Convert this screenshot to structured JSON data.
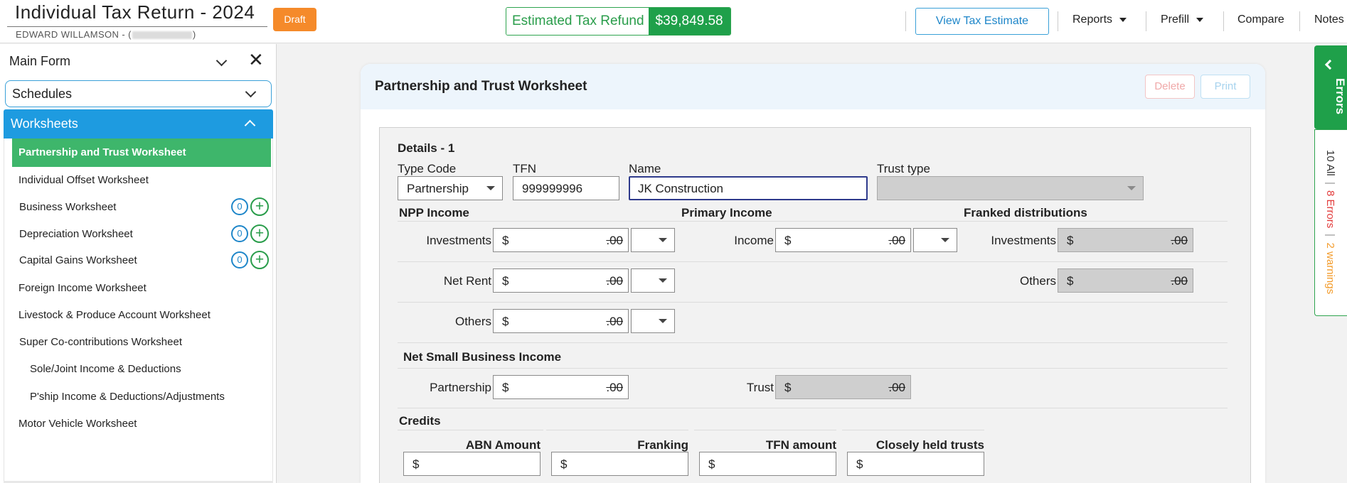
{
  "header": {
    "title": "Individual Tax Return - 2024",
    "client_name": "EDWARD WILLAMSON - (",
    "client_close": ")",
    "status_badge": "Draft",
    "refund_label": "Estimated Tax Refund",
    "refund_amount": "$39,849.58",
    "view_estimate": "View Tax Estimate",
    "menu": {
      "reports": "Reports",
      "prefill": "Prefill",
      "compare": "Compare",
      "notes": "Notes"
    }
  },
  "sidebar": {
    "main_form": "Main Form",
    "schedules": "Schedules",
    "worksheets": "Worksheets",
    "items": [
      {
        "label": "Partnership and Trust Worksheet",
        "active": true
      },
      {
        "label": "Individual Offset Worksheet"
      },
      {
        "label": "Business Worksheet",
        "count": "0"
      },
      {
        "label": "Depreciation Worksheet",
        "count": "0"
      },
      {
        "label": "Capital Gains Worksheet",
        "count": "0"
      },
      {
        "label": "Foreign Income Worksheet"
      },
      {
        "label": "Livestock & Produce Account Worksheet"
      },
      {
        "label": "Super Co-contributions Worksheet"
      },
      {
        "label": "Sole/Joint Income & Deductions"
      },
      {
        "label": "P'ship Income & Deductions/Adjustments"
      },
      {
        "label": "Motor Vehicle Worksheet"
      }
    ]
  },
  "errors_panel": {
    "tab_label": "Errors",
    "all": "10 All",
    "errors": "8 Errors",
    "warnings": "2 warnings",
    "separator": "|"
  },
  "card": {
    "title": "Partnership and Trust Worksheet",
    "delete": "Delete",
    "print": "Print"
  },
  "form": {
    "section_title": "Details - 1",
    "type_code_label": "Type Code",
    "type_code_value": "Partnership",
    "tfn_label": "TFN",
    "tfn_value": "999999996",
    "name_label": "Name",
    "name_value": "JK Construction",
    "trust_type_label": "Trust type",
    "currency": "$",
    "cents": ".00",
    "npp_income": {
      "heading": "NPP Income",
      "investments": "Investments",
      "net_rent": "Net Rent",
      "others": "Others"
    },
    "primary_income": {
      "heading": "Primary Income",
      "income": "Income"
    },
    "franked": {
      "heading": "Franked distributions",
      "investments": "Investments",
      "others": "Others"
    },
    "nsbi": {
      "heading": "Net Small Business Income",
      "partnership": "Partnership",
      "trust": "Trust"
    },
    "credits": {
      "heading": "Credits",
      "abn": "ABN Amount",
      "franking": "Franking",
      "tfn_amount": "TFN amount",
      "closely_held": "Closely held trusts"
    }
  }
}
